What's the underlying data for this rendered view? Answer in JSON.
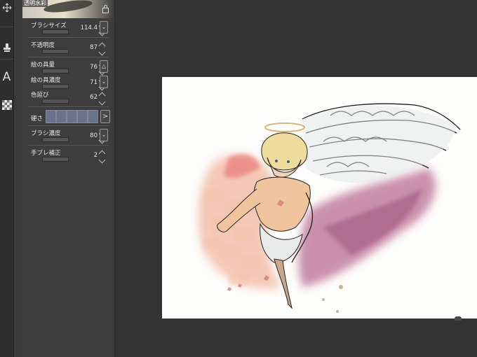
{
  "toolbar": {
    "tools": [
      "move-icon",
      "stamp-icon",
      "text-tool-icon",
      "transparency-icon"
    ],
    "text_tool_glyph": "A"
  },
  "brush_panel": {
    "preset_name": "透明水彩",
    "brush_size": {
      "label": "ブラシサイズ",
      "value": "114.4"
    },
    "opacity": {
      "label": "不透明度",
      "value": "87"
    },
    "paint_amount": {
      "label": "絵の具量",
      "value": "76"
    },
    "paint_density": {
      "label": "絵の具濃度",
      "value": "71"
    },
    "color_stretch": {
      "label": "色延び",
      "value": "62"
    },
    "hardness": {
      "label": "硬さ",
      "next_glyph": ">"
    },
    "brush_density": {
      "label": "ブラシ濃度",
      "value": "80"
    },
    "stabilization": {
      "label": "手ブレ補正",
      "value": "2"
    },
    "glyphs": {
      "chevron_double": "⌄",
      "triangle_up": "△"
    }
  },
  "colors": {
    "panel_bg": "#3d3d3d",
    "hardness_blue": "#6a7389",
    "canvas_bg": "#fdfdfb"
  }
}
